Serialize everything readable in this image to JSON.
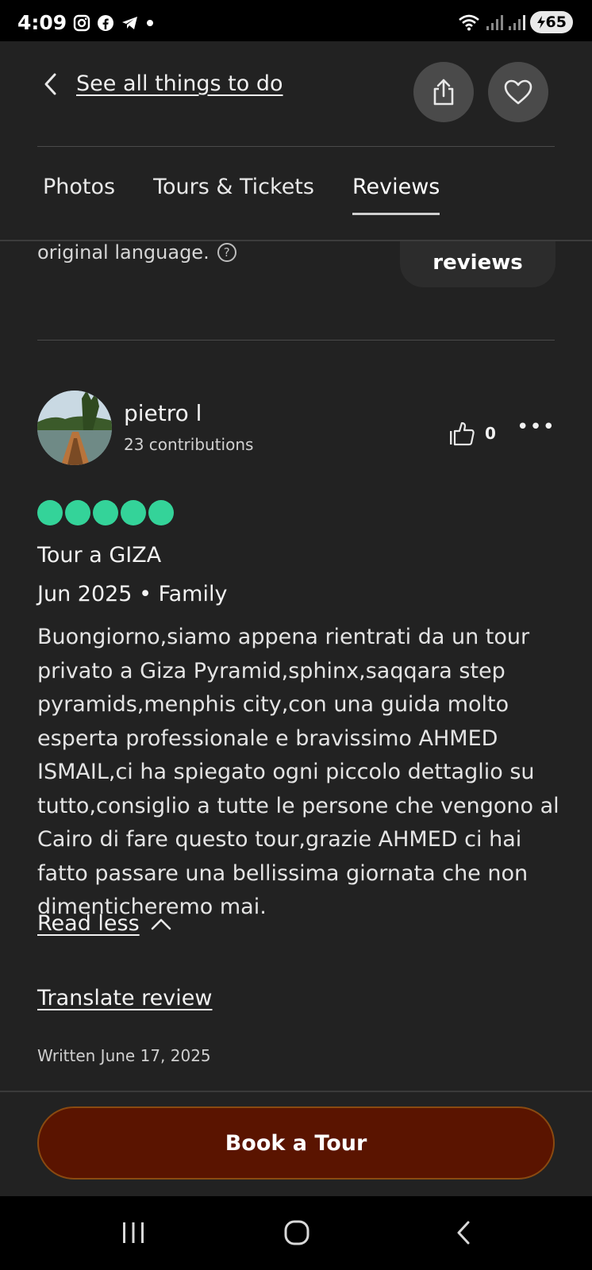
{
  "status_bar": {
    "time": "4:09",
    "battery": "65",
    "left_icons": [
      "instagram-icon",
      "facebook-icon",
      "telegram-icon",
      "dot-icon"
    ],
    "right_icons": [
      "wifi-icon",
      "signal-icon",
      "signal-icon",
      "battery-icon"
    ]
  },
  "header": {
    "back_label": "See all things to do",
    "share_icon": "share-icon",
    "favorite_icon": "heart-icon"
  },
  "tabs": [
    {
      "label": "Photos",
      "active": false
    },
    {
      "label": "Tours & Tickets",
      "active": false
    },
    {
      "label": "Reviews",
      "active": true
    }
  ],
  "partial": {
    "text": "original language.",
    "help": "?",
    "reviews_button": "reviews"
  },
  "review": {
    "author": "pietro l",
    "contributions": "23 contributions",
    "helpful_count": "0",
    "more": "•••",
    "rating": 5,
    "rating_color": "#34d399",
    "title": "Tour a GIZA",
    "meta": "Jun 2025 • Family",
    "body": "Buongiorno,siamo appena rientrati da un tour privato a Giza Pyramid,sphinx,saqqara step pyramids,menphis city,con una guida molto esperta professionale e bravissimo AHMED ISMAIL,ci ha spiegato ogni piccolo dettaglio su tutto,consiglio a tutte le persone che vengono al Cairo di fare questo tour,grazie AHMED ci hai fatto passare una bellissima giornata che non dimenticheremo mai.",
    "read_less": "Read less",
    "translate": "Translate review",
    "written": "Written June 17, 2025"
  },
  "cta": {
    "label": "Book a Tour",
    "color": "#5a1400"
  },
  "system_nav": [
    "recents-icon",
    "home-icon",
    "back-icon"
  ]
}
